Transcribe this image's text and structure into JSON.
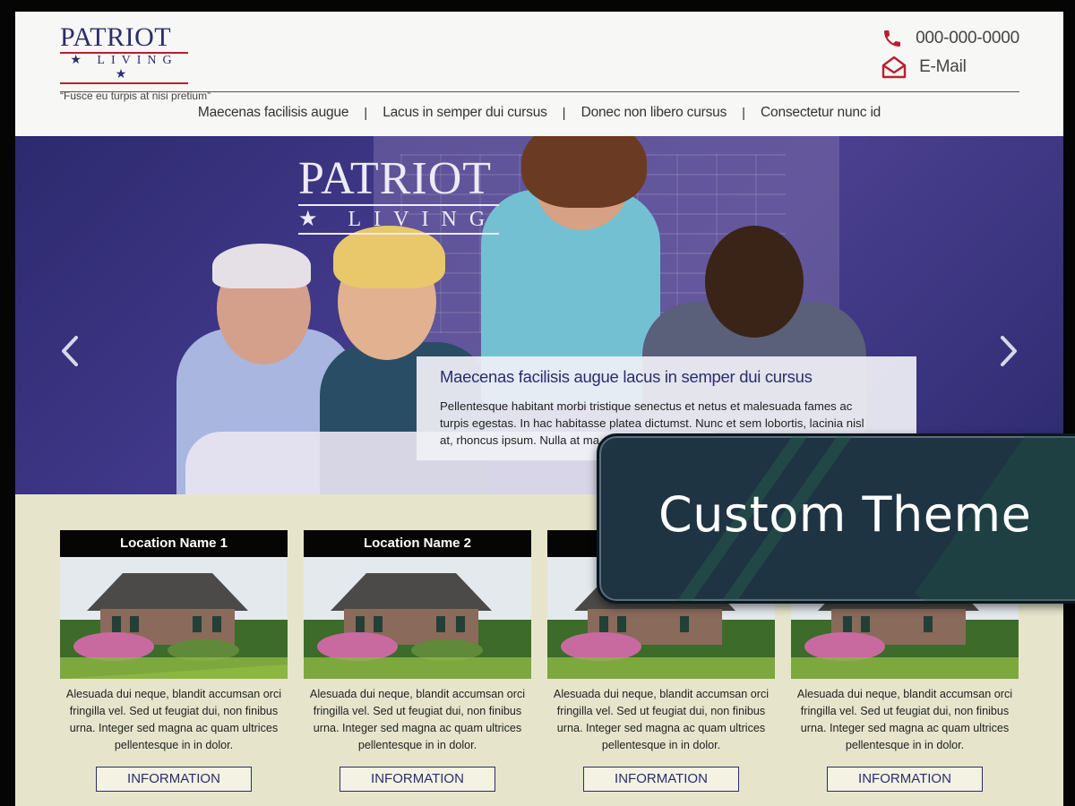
{
  "header": {
    "logo_main": "PATRIOT",
    "logo_sub": "★ LIVING ★",
    "tagline": "“Fusce eu turpis at nisi pretium”",
    "phone": "000-000-0000",
    "email_label": "E-Mail"
  },
  "nav": {
    "items": [
      "Maecenas facilisis augue",
      "Lacus in semper dui cursus",
      "Donec non libero cursus",
      "Consectetur nunc id"
    ],
    "separator": "|"
  },
  "hero": {
    "logo_main": "PATRIOT",
    "logo_sub": "★ LIVING",
    "caption_title": "Maecenas facilisis augue lacus in semper dui cursus",
    "caption_body": "Pellentesque habitant morbi tristique senectus et netus et malesuada fames ac turpis egestas. In hac habitasse platea dictumst. Nunc et sem lobortis, lacinia nisl at, rhoncus ipsum. Nulla at ma"
  },
  "locations": [
    {
      "name": "Location Name 1",
      "text": "Alesuada dui neque, blandit accumsan orci fringilla vel. Sed ut feugiat dui, non finibus urna. Integer sed magna ac quam ultrices pellentesque in in dolor.",
      "button": "INFORMATION"
    },
    {
      "name": "Location Name 2",
      "text": "Alesuada dui neque, blandit accumsan orci fringilla vel. Sed ut feugiat dui, non finibus urna. Integer sed magna ac quam ultrices pellentesque in in dolor.",
      "button": "INFORMATION"
    },
    {
      "name": "",
      "text": "Alesuada dui neque, blandit accumsan orci fringilla vel. Sed ut feugiat dui, non finibus urna. Integer sed magna ac quam ultrices pellentesque in in dolor.",
      "button": "INFORMATION"
    },
    {
      "name": "",
      "text": "Alesuada dui neque, blandit accumsan orci fringilla vel. Sed ut feugiat dui, non finibus urna. Integer sed magna ac quam ultrices pellentesque in in dolor.",
      "button": "INFORMATION"
    }
  ],
  "badge": {
    "label": "Custom Theme"
  },
  "icons": {
    "phone": "phone-icon",
    "email": "envelope-icon",
    "prev": "chevron-left-icon",
    "next": "chevron-right-icon"
  },
  "colors": {
    "brand_navy": "#2a2d6e",
    "brand_red": "#b8202f",
    "hero_purple": "#413889",
    "lower_bg": "#e6e5cb",
    "badge_bg": "#1f3443"
  }
}
